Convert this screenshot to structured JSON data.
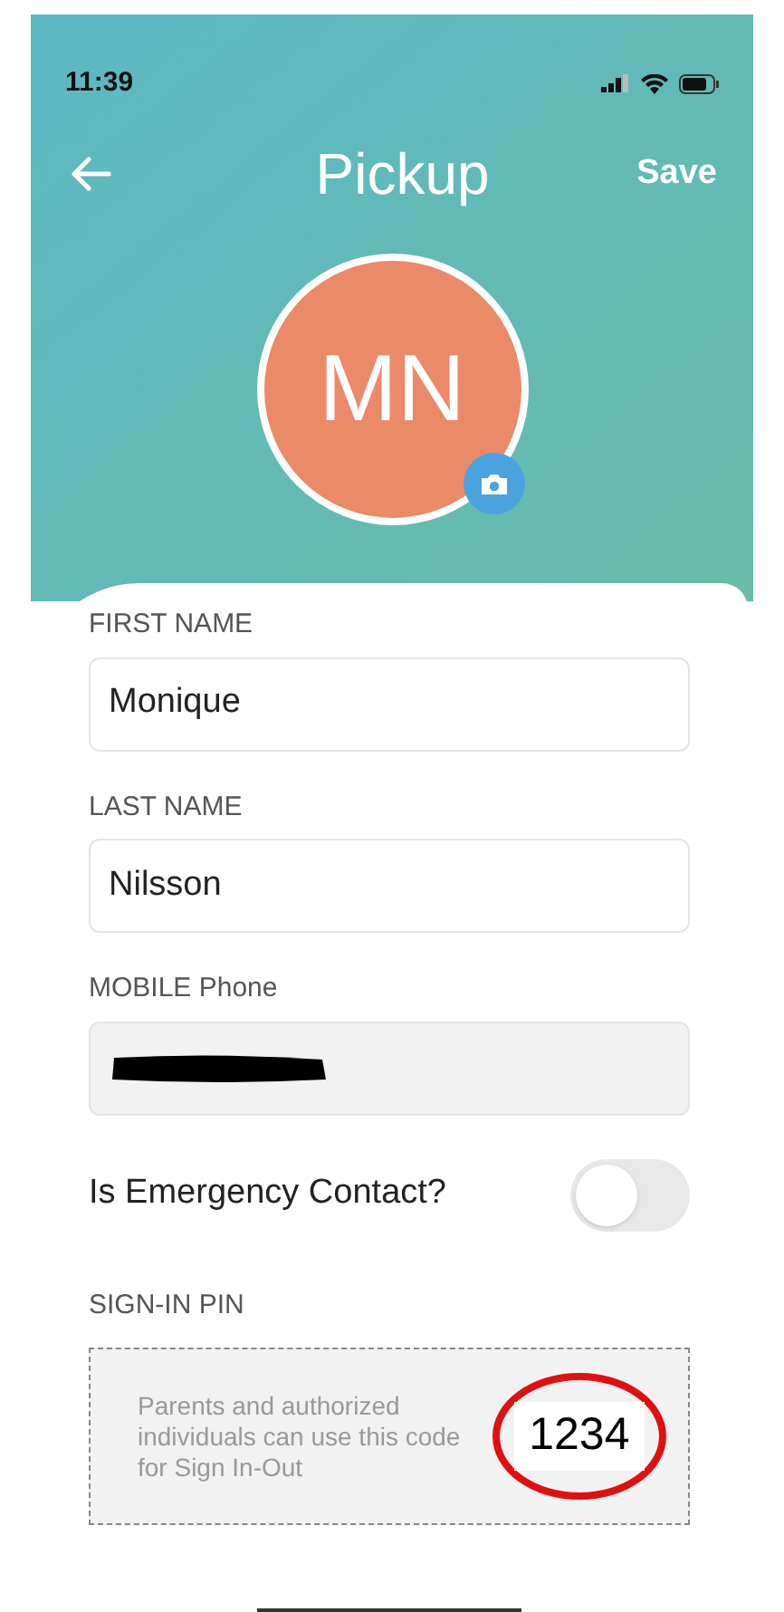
{
  "status_bar": {
    "time": "11:39"
  },
  "header": {
    "title": "Pickup",
    "action": "Save"
  },
  "avatar": {
    "initials": "MN",
    "color": "#ea8a68"
  },
  "fields": [
    {
      "label": "FIRST NAME",
      "value": "Monique",
      "disabled": false,
      "redacted": false
    },
    {
      "label": "LAST NAME",
      "value": "Nilsson",
      "disabled": false,
      "redacted": false
    },
    {
      "label": "MOBILE Phone",
      "disabled": true,
      "redacted": true
    }
  ],
  "emergency_contact": {
    "label": "Is Emergency Contact?",
    "on": false
  },
  "pin": {
    "label": "SIGN-IN PIN",
    "description": "Parents and authorized individuals can use this code for Sign In-Out",
    "code": "1234",
    "circled": true
  }
}
